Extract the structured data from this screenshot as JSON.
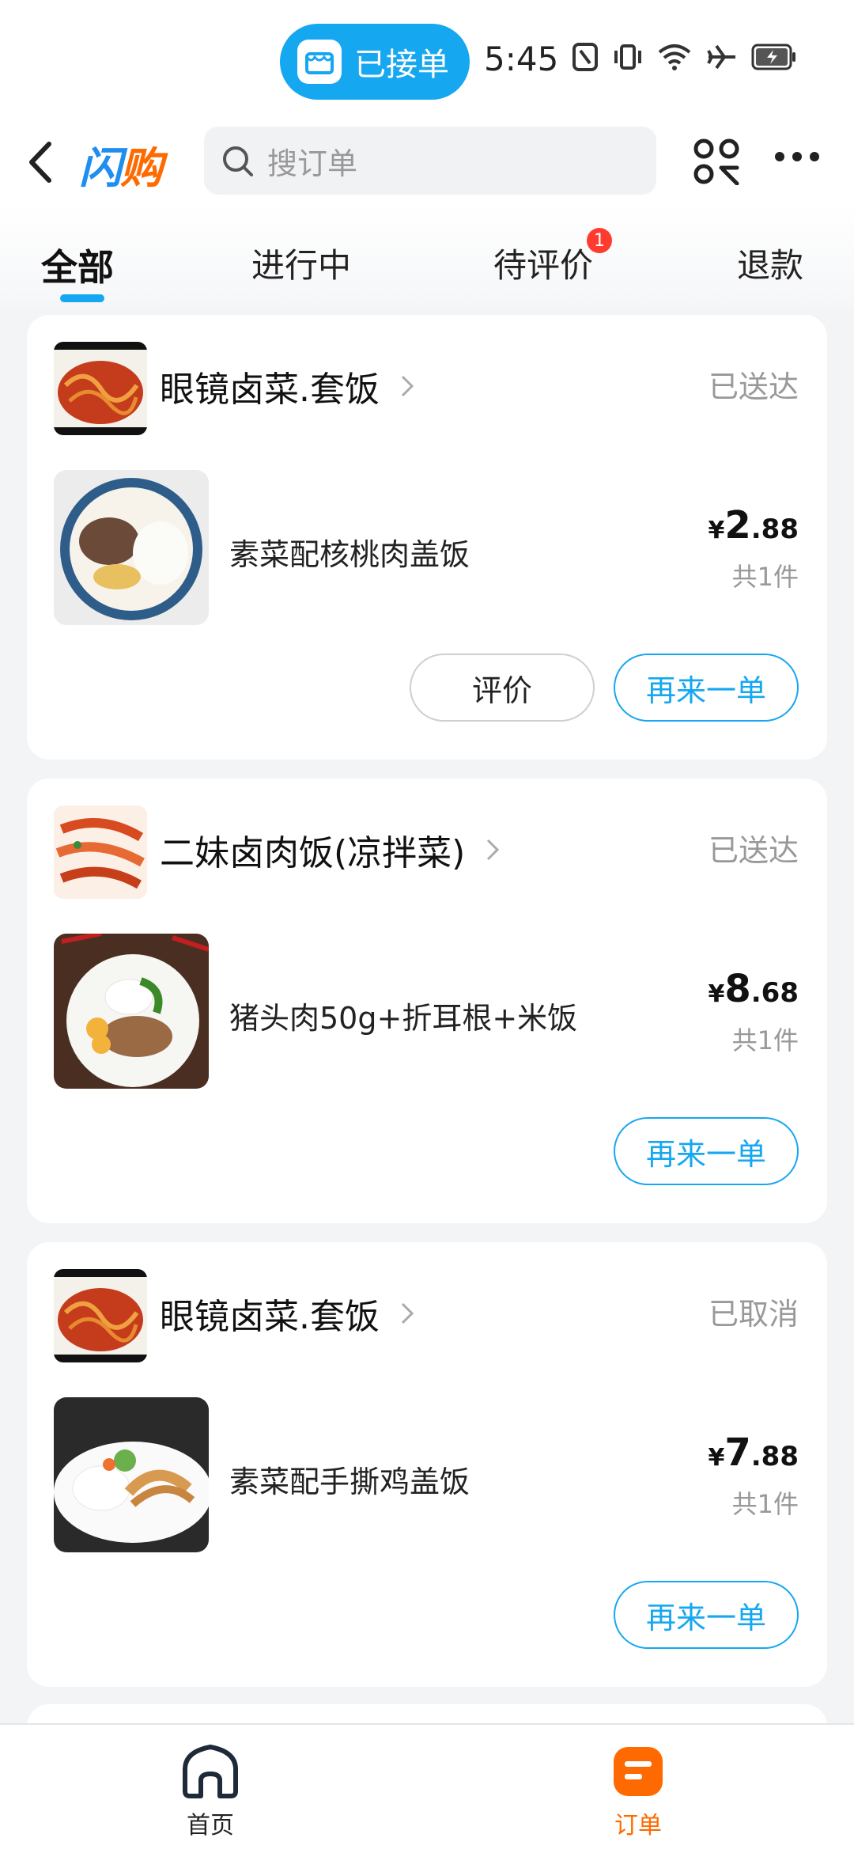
{
  "status_bar": {
    "pill_label": "已接单",
    "time": "5:45"
  },
  "header": {
    "logo": {
      "part1": "闪",
      "part2": "购"
    },
    "search_placeholder": "搜订单"
  },
  "tabs": [
    {
      "label": "全部",
      "active": true
    },
    {
      "label": "进行中"
    },
    {
      "label": "待评价",
      "badge": "1"
    },
    {
      "label": "退款"
    }
  ],
  "orders": [
    {
      "shop": "眼镜卤菜.套饭",
      "status": "已送达",
      "item": "素菜配核桃肉盖饭",
      "price_symbol": "¥",
      "price_int": "2",
      "price_dec": ".88",
      "qty": "共1件",
      "review_label": "评价",
      "reorder_label": "再来一单"
    },
    {
      "shop": "二妹卤肉饭(凉拌菜)",
      "status": "已送达",
      "item": "猪头肉50g+折耳根+米饭",
      "price_symbol": "¥",
      "price_int": "8",
      "price_dec": ".68",
      "qty": "共1件",
      "reorder_label": "再来一单"
    },
    {
      "shop": "眼镜卤菜.套饭",
      "status": "已取消",
      "item": "素菜配手撕鸡盖饭",
      "price_symbol": "¥",
      "price_int": "7",
      "price_dec": ".88",
      "qty": "共1件",
      "reorder_label": "再来一单"
    }
  ],
  "bottom_nav": {
    "home": "首页",
    "orders": "订单"
  },
  "colors": {
    "accent": "#16a7f1",
    "brand_orange": "#ff6a00",
    "badge_red": "#ff3b30"
  }
}
